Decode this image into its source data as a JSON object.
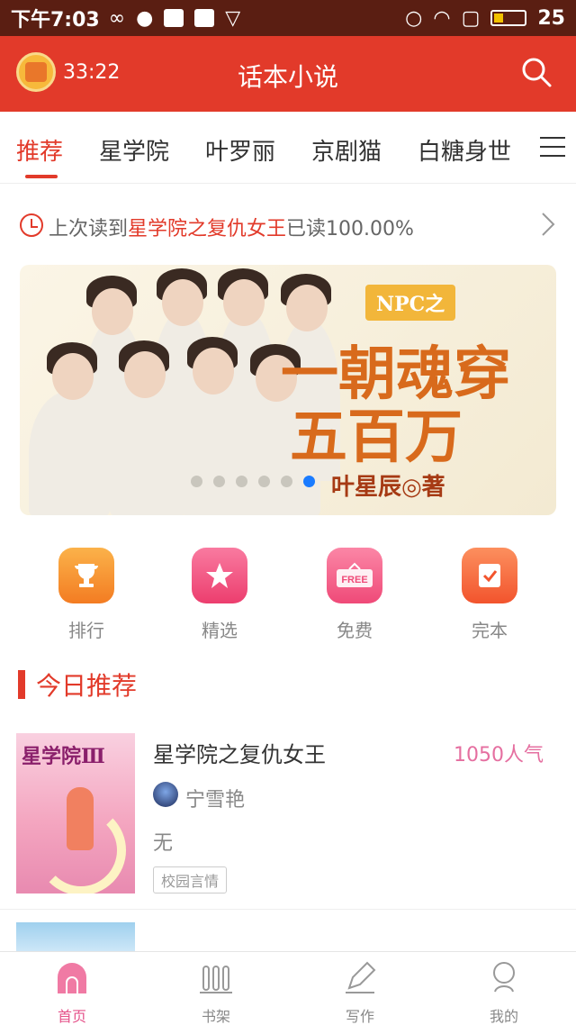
{
  "status_bar": {
    "time": "下午7:03",
    "battery": "25"
  },
  "header": {
    "timer": "33:22",
    "title": "话本小说"
  },
  "tabs": [
    {
      "label": "推荐",
      "active": true
    },
    {
      "label": "星学院"
    },
    {
      "label": "叶罗丽"
    },
    {
      "label": "京剧猫"
    },
    {
      "label": "白糖身世"
    }
  ],
  "last_read": {
    "prefix": "上次读到",
    "book": "星学院之复仇女王",
    "suffix": "已读100.00%"
  },
  "banner": {
    "badge": "NPC之",
    "line1": "一朝魂穿",
    "line2": "五百万",
    "author": "叶星辰◎著",
    "dots_total": 6,
    "active_dot": 6
  },
  "quick_nav": [
    {
      "label": "排行",
      "icon": "trophy-icon",
      "color": "#f7922f"
    },
    {
      "label": "精选",
      "icon": "star-icon",
      "color": "#f0527d"
    },
    {
      "label": "免费",
      "icon": "free-icon",
      "color": "#f2628a"
    },
    {
      "label": "完本",
      "icon": "check-icon",
      "color": "#f56a45"
    }
  ],
  "section": {
    "title": "今日推荐"
  },
  "books": [
    {
      "title": "星学院之复仇女王",
      "popularity": "1050人气",
      "author": "宁雪艳",
      "description": "无",
      "tag": "校园言情",
      "cover_text": "星学院Ⅲ"
    }
  ],
  "bottom_nav": [
    {
      "label": "首页",
      "icon": "home-icon",
      "active": true
    },
    {
      "label": "书架",
      "icon": "bookshelf-icon"
    },
    {
      "label": "写作",
      "icon": "pen-icon"
    },
    {
      "label": "我的",
      "icon": "profile-icon"
    }
  ],
  "colors": {
    "brand": "#e23a2a",
    "accent_pink": "#e5528a",
    "status_bar": "#5a1e12"
  }
}
